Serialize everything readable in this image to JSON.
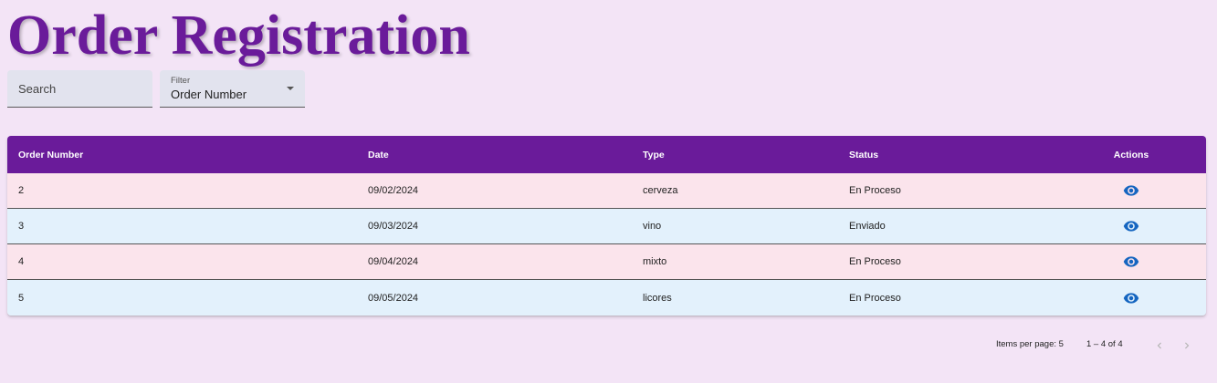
{
  "page": {
    "title": "Order Registration"
  },
  "search": {
    "placeholder": "Search"
  },
  "filter": {
    "label": "Filter",
    "selected": "Order Number"
  },
  "table": {
    "columns": [
      "Order Number",
      "Date",
      "Type",
      "Status",
      "Actions"
    ],
    "rows": [
      {
        "order_number": "2",
        "date": "09/02/2024",
        "type": "cerveza",
        "status": "En Proceso"
      },
      {
        "order_number": "3",
        "date": "09/03/2024",
        "type": "vino",
        "status": "Enviado"
      },
      {
        "order_number": "4",
        "date": "09/04/2024",
        "type": "mixto",
        "status": "En Proceso"
      },
      {
        "order_number": "5",
        "date": "09/05/2024",
        "type": "licores",
        "status": "En Proceso"
      }
    ],
    "row_action_icon": "eye-icon"
  },
  "paginator": {
    "items_per_page_label": "Items per page:",
    "items_per_page_value": "5",
    "range_label": "1 – 4 of 4",
    "prev_icon": "chevron-left-icon",
    "next_icon": "chevron-right-icon"
  },
  "colors": {
    "background": "#f3e4f6",
    "title": "#6a1b9a",
    "header": "#6a1b9a",
    "row_odd": "#fbe4ec",
    "row_even": "#e3f1fc",
    "icon": "#1565c0"
  }
}
